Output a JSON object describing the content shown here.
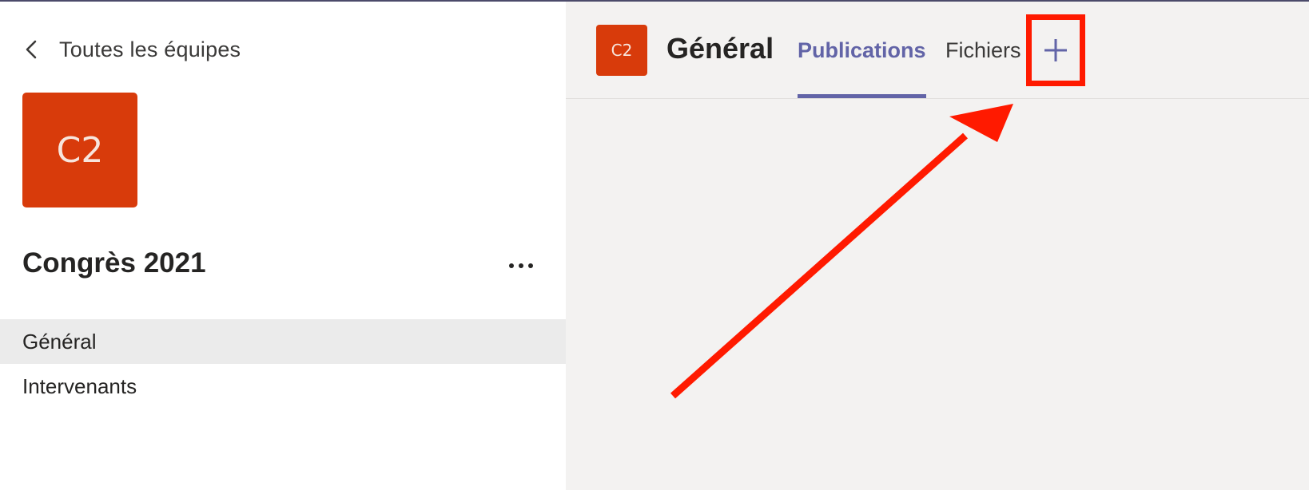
{
  "sidebar": {
    "back_label": "Toutes les équipes",
    "team_initials": "C2",
    "team_name": "Congrès 2021",
    "channels": [
      {
        "label": "Général",
        "selected": true
      },
      {
        "label": "Intervenants",
        "selected": false
      }
    ]
  },
  "header": {
    "channel_initials": "C2",
    "channel_title": "Général",
    "tabs": [
      {
        "label": "Publications",
        "active": true
      },
      {
        "label": "Fichiers",
        "active": false
      }
    ]
  },
  "colors": {
    "accent": "#6264a7",
    "team_avatar": "#d83b0b",
    "annotation": "#ff1a00"
  },
  "icons": {
    "back": "chevron-left-icon",
    "more": "more-options-icon",
    "add_tab": "plus-icon",
    "annotation": "arrow-annotation"
  }
}
